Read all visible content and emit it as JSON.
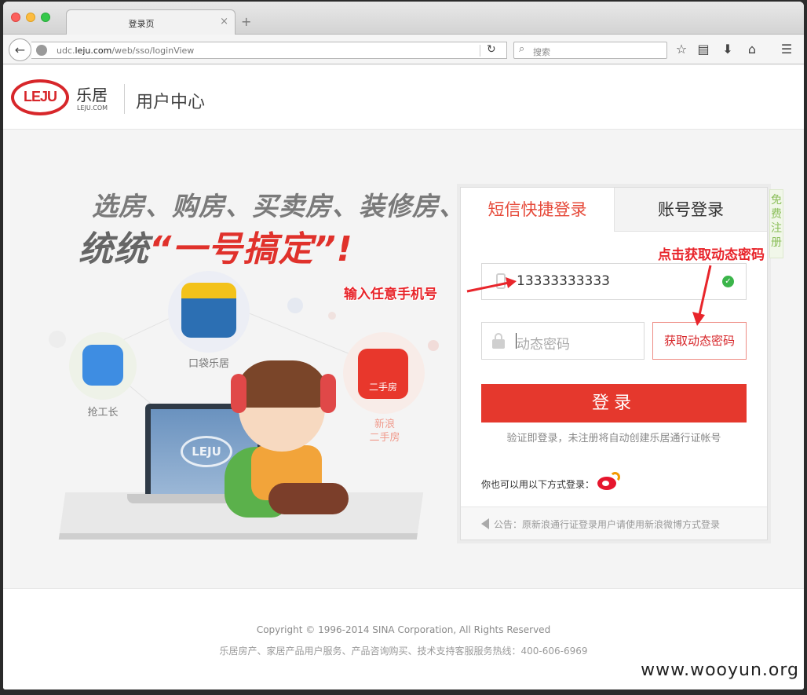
{
  "browser": {
    "tab_title": "登录页",
    "tab_close": "×",
    "new_tab": "+",
    "url_prefix": "udc.",
    "url_domain": "leju.com",
    "url_path": "/web/sso/loginView",
    "search_placeholder": "搜索"
  },
  "header": {
    "logo_text": "LEJU",
    "logo_cn": "乐居",
    "logo_sub": "LEJU.COM",
    "title": "用户中心"
  },
  "banner": {
    "slogan_line1": "选房、购房、买卖房、装修房、",
    "slogan_line2_prefix": "统统",
    "slogan_line2_red": "“一号搞定”!",
    "apps": [
      {
        "label": "口袋乐居"
      },
      {
        "label": "抢工长"
      },
      {
        "label": "新浪二手房",
        "label_l1": "新浪",
        "label_l2": "二手房",
        "icon_text": "二手房"
      }
    ],
    "laptop_logo": "LEJU"
  },
  "login": {
    "tab_sms": "短信快捷登录",
    "tab_account": "账号登录",
    "free_register": "免费注册",
    "phone_value": "13333333333",
    "code_placeholder": "动态密码",
    "get_code_button": "获取动态密码",
    "login_button": "登录",
    "hint": "验证即登录，未注册将自动创建乐居通行证帐号",
    "other_methods": "你也可以用以下方式登录：",
    "notice": "公告：原新浪通行证登录用户请使用新浪微博方式登录"
  },
  "annotations": {
    "input_phone": "输入任意手机号",
    "click_get_code": "点击获取动态密码"
  },
  "footer": {
    "copyright": "Copyright © 1996-2014 SINA Corporation, All Rights Reserved",
    "service": "乐居房产、家居产品用户服务、产品咨询购买、技术支持客服服务热线：400-606-6969"
  },
  "watermark": "www.wooyun.org",
  "colors": {
    "brand_red": "#d7262a",
    "button_red": "#e5382d",
    "active_tab": "#e64a3a",
    "register_green": "#8cbf5b"
  }
}
